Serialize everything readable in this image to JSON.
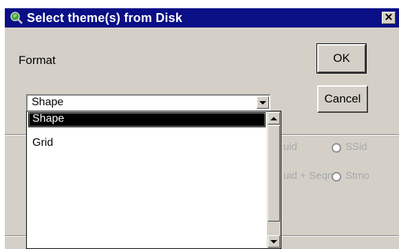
{
  "window": {
    "title": "Select theme(s) from Disk",
    "close_glyph": "✕",
    "icon": "globe-magnifier-icon"
  },
  "form": {
    "format_label": "Format"
  },
  "buttons": {
    "ok_label": "OK",
    "cancel_label": "Cancel"
  },
  "format_select": {
    "value": "Shape",
    "options": [
      {
        "label": "Shape",
        "selected": true
      },
      {
        "label": "Grid",
        "selected": false
      }
    ]
  },
  "radio_options": [
    {
      "label": "uid"
    },
    {
      "label": "SSid"
    },
    {
      "label": "uid + Seqn"
    },
    {
      "label": "Stmo"
    }
  ],
  "colors": {
    "title_bar": "#0a0f86",
    "dialog_face": "#d4d0c8",
    "selection": "#000000"
  }
}
